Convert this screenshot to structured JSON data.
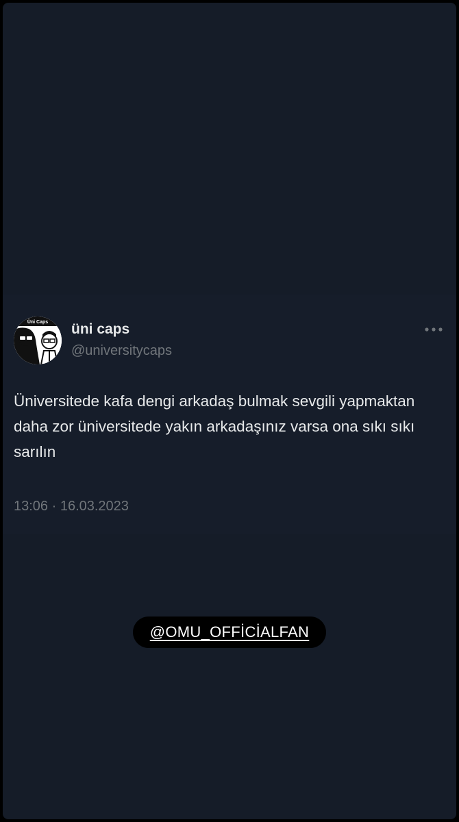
{
  "tweet": {
    "avatar_logo_text": "Üni Caps",
    "display_name": "üni caps",
    "handle": "@universitycaps",
    "more_icon": "more-horizontal-icon",
    "text": "Üniversitede kafa dengi arkadaş bulmak sevgili yapmaktan daha zor üniversitede yakın arkadaşınız varsa ona sıkı sıkı sarılın",
    "timestamp": "13:06 · 16.03.2023"
  },
  "sticker": {
    "mention": "@OMU_OFFİCİALFAN"
  },
  "colors": {
    "background": "#151c28",
    "tweet_background": "#161d2a",
    "primary_text": "#e7e9ea",
    "secondary_text": "#71767b",
    "sticker_background": "#000000"
  }
}
